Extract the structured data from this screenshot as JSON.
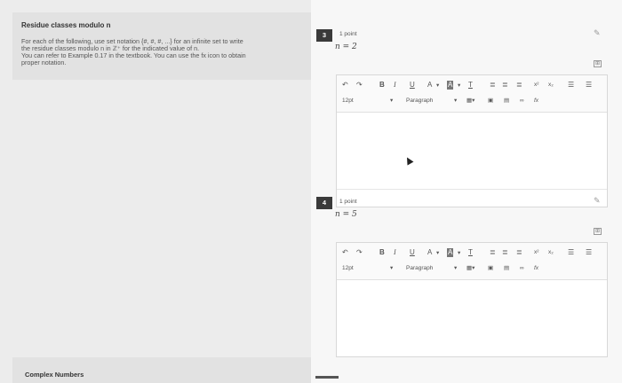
{
  "intro": {
    "title": "Residue classes modulo n",
    "line1": "For each of the following, use set notation {#, #, #, ...} for an infinite set to write",
    "line2": "the residue classes modulo n in ℤ⁺ for the indicated value of n.",
    "line3": "You can refer to Example 0.17 in the textbook. You can use the fx icon to obtain",
    "line4": "proper notation."
  },
  "bottom_tab": {
    "label": "Complex Numbers"
  },
  "questions": [
    {
      "number": "3",
      "points": "1 point",
      "value": "n = 2"
    },
    {
      "number": "4",
      "points": "1 point",
      "value": "n = 5"
    }
  ],
  "toolbar": {
    "undo": "↶",
    "redo": "↷",
    "bold": "B",
    "italic": "I",
    "underline": "U",
    "text_color": "A",
    "highlight": "A",
    "clear_format": "T",
    "superscript": "x²",
    "subscript": "x₂",
    "font_size": "12pt",
    "paragraph": "Paragraph",
    "dropdown_arrow": "▾",
    "fx": "fx"
  },
  "icons": {
    "pin": "pin-icon",
    "expand": "expand-icon"
  },
  "colors": {
    "badge": "#3a3a3a",
    "panel": "#e2e2e2"
  }
}
